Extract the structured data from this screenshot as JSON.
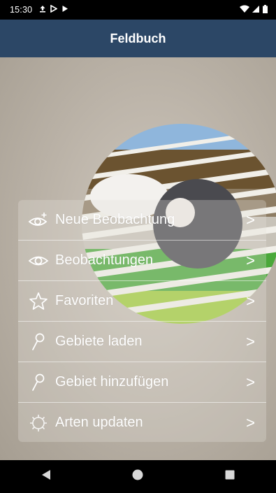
{
  "status_bar": {
    "time": "15:30",
    "notification_icons": [
      "upload-icon",
      "play-store-icon",
      "play-icon"
    ],
    "system_icons": [
      "wifi-icon",
      "signal-icon",
      "battery-icon"
    ]
  },
  "app_bar": {
    "title": "Feldbuch"
  },
  "menu": {
    "items": [
      {
        "label": "Neue Beobachtung",
        "icon": "eye-plus-icon",
        "chevron": ">"
      },
      {
        "label": "Beobachtungen",
        "icon": "eye-icon",
        "chevron": ">"
      },
      {
        "label": "Favoriten",
        "icon": "star-icon",
        "chevron": ">"
      },
      {
        "label": "Gebiete laden",
        "icon": "pin-icon",
        "chevron": ">"
      },
      {
        "label": "Gebiet hinzufügen",
        "icon": "pin-icon",
        "chevron": ">"
      },
      {
        "label": "Arten updaten",
        "icon": "sync-icon",
        "chevron": ">"
      }
    ]
  },
  "nav_bar": {
    "buttons": [
      "back-icon",
      "home-icon",
      "recents-icon"
    ]
  },
  "colors": {
    "app_bar": "#2c4766",
    "menu_text": "#ffffff"
  }
}
